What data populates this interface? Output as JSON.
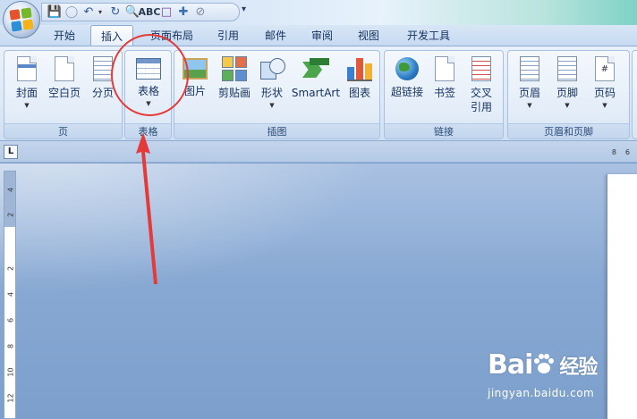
{
  "quick_access": {
    "icons": [
      "save-icon",
      "circle-icon",
      "undo-icon",
      "redo-icon",
      "print-preview-icon",
      "spelling-icon",
      "page-icon",
      "insert-icon",
      "no-edit-icon"
    ]
  },
  "tabs": [
    {
      "label": "开始",
      "active": false
    },
    {
      "label": "插入",
      "active": true
    },
    {
      "label": "页面布局",
      "active": false
    },
    {
      "label": "引用",
      "active": false
    },
    {
      "label": "邮件",
      "active": false
    },
    {
      "label": "审阅",
      "active": false
    },
    {
      "label": "视图",
      "active": false
    },
    {
      "label": "开发工具",
      "active": false
    }
  ],
  "ribbon": {
    "groups": {
      "pages": {
        "label": "页",
        "buttons": [
          "封面",
          "空白页",
          "分页"
        ]
      },
      "tables": {
        "label": "表格",
        "buttons": [
          "表格"
        ]
      },
      "illustrations": {
        "label": "插图",
        "buttons": [
          "图片",
          "剪贴画",
          "形状",
          "SmartArt",
          "图表"
        ]
      },
      "links": {
        "label": "链接",
        "buttons": [
          "超链接",
          "书签",
          "交叉",
          "引用"
        ]
      },
      "header_footer": {
        "label": "页眉和页脚",
        "buttons": [
          "页眉",
          "页脚",
          "页码"
        ]
      }
    }
  },
  "ruler": {
    "corner_mark": "L",
    "top_numbers": [
      "8",
      "6"
    ],
    "left_numbers": [
      "4",
      "2",
      "2",
      "4",
      "6",
      "8",
      "10",
      "12"
    ]
  },
  "colors": {
    "annotation": "#e53a3a",
    "active_tab": "#fdfeff",
    "doc_background": "#88a9d3"
  },
  "watermark": {
    "brand": "Bai",
    "brand_suffix": "经验",
    "url": "jingyan.baidu.com"
  }
}
